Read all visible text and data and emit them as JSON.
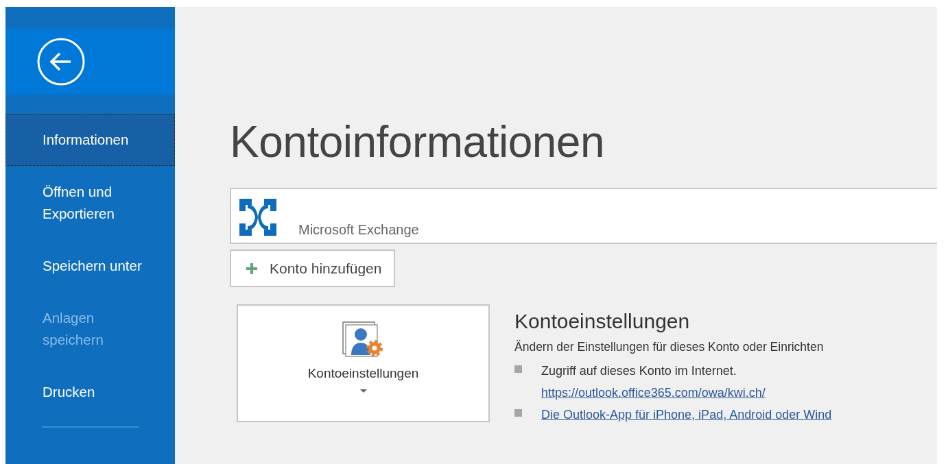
{
  "sidebar": {
    "items": [
      {
        "label": "Informationen",
        "selected": true,
        "disabled": false
      },
      {
        "label": "Öffnen und Exportieren",
        "selected": false,
        "disabled": false
      },
      {
        "label": "Speichern unter",
        "selected": false,
        "disabled": false
      },
      {
        "label": "Anlagen speichern",
        "selected": false,
        "disabled": true
      },
      {
        "label": "Drucken",
        "selected": false,
        "disabled": false
      }
    ]
  },
  "page_title": "Kontoinformationen",
  "account": {
    "type": "Microsoft Exchange"
  },
  "add_account_button": {
    "label": "Konto hinzufügen"
  },
  "settings_tile": {
    "label": "Kontoeinstellungen"
  },
  "settings_section": {
    "title": "Kontoeinstellungen",
    "description": "Ändern der Einstellungen für dieses Konto oder Einrichten",
    "bullets": [
      {
        "text": "Zugriff auf dieses Konto im Internet.",
        "link": "https://outlook.office365.com/owa/kwi.ch/"
      },
      {
        "link": "Die Outlook-App für iPhone, iPad, Android oder Wind"
      }
    ]
  }
}
